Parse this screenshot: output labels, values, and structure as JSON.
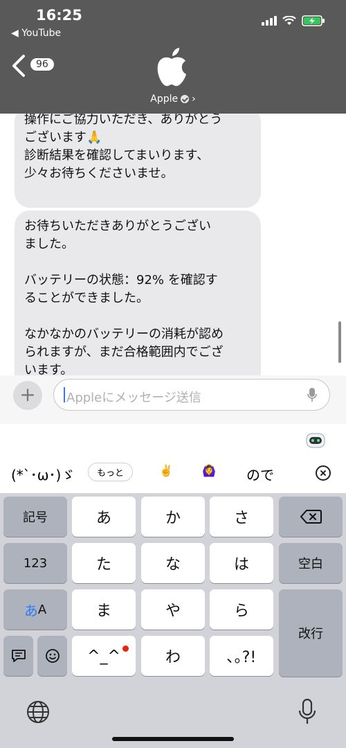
{
  "status_bar": {
    "time": "16:25",
    "back_app": "◀ YouTube"
  },
  "header": {
    "unread_count": "96",
    "contact_name": "Apple",
    "chevron": "›"
  },
  "messages": [
    {
      "lines": [
        "操作にご協力いただき、ありがとう",
        "ございます🙏",
        "診断結果を確認してまいります、",
        "少々お待ちくださいませ。"
      ]
    },
    {
      "lines": [
        "お待ちいただきありがとうござい",
        "ました。",
        "",
        "バッテリーの状態：92% を確認す",
        "ることができました。",
        "",
        "なかなかのバッテリーの消耗が認め",
        "られますが、まだ合格範囲内でござ",
        "います。"
      ]
    }
  ],
  "composer": {
    "plus": "+",
    "placeholder": "Appleにメッセージ送信"
  },
  "predictions": {
    "kaomoji": "(*`･ω･)ゞ",
    "more": "もっと",
    "emoji1": "✌️",
    "emoji2": "🙆‍♀️",
    "word": "ので"
  },
  "keyboard": {
    "kigou": "記号",
    "num": "123",
    "kana_a": "あ",
    "kana_A": "A",
    "row1": [
      "あ",
      "か",
      "さ"
    ],
    "row2": [
      "た",
      "な",
      "は"
    ],
    "row3": [
      "ま",
      "や",
      "ら"
    ],
    "row4": [
      "^_^",
      "わ",
      "､｡?!"
    ],
    "space": "空白",
    "return": "改行"
  },
  "icons": [
    "back-chevron-icon",
    "apple-logo-icon",
    "verified-icon",
    "mic-icon",
    "robot-icon",
    "close-icon",
    "delete-icon",
    "memo-icon",
    "smile-icon",
    "globe-icon",
    "dictation-icon"
  ]
}
